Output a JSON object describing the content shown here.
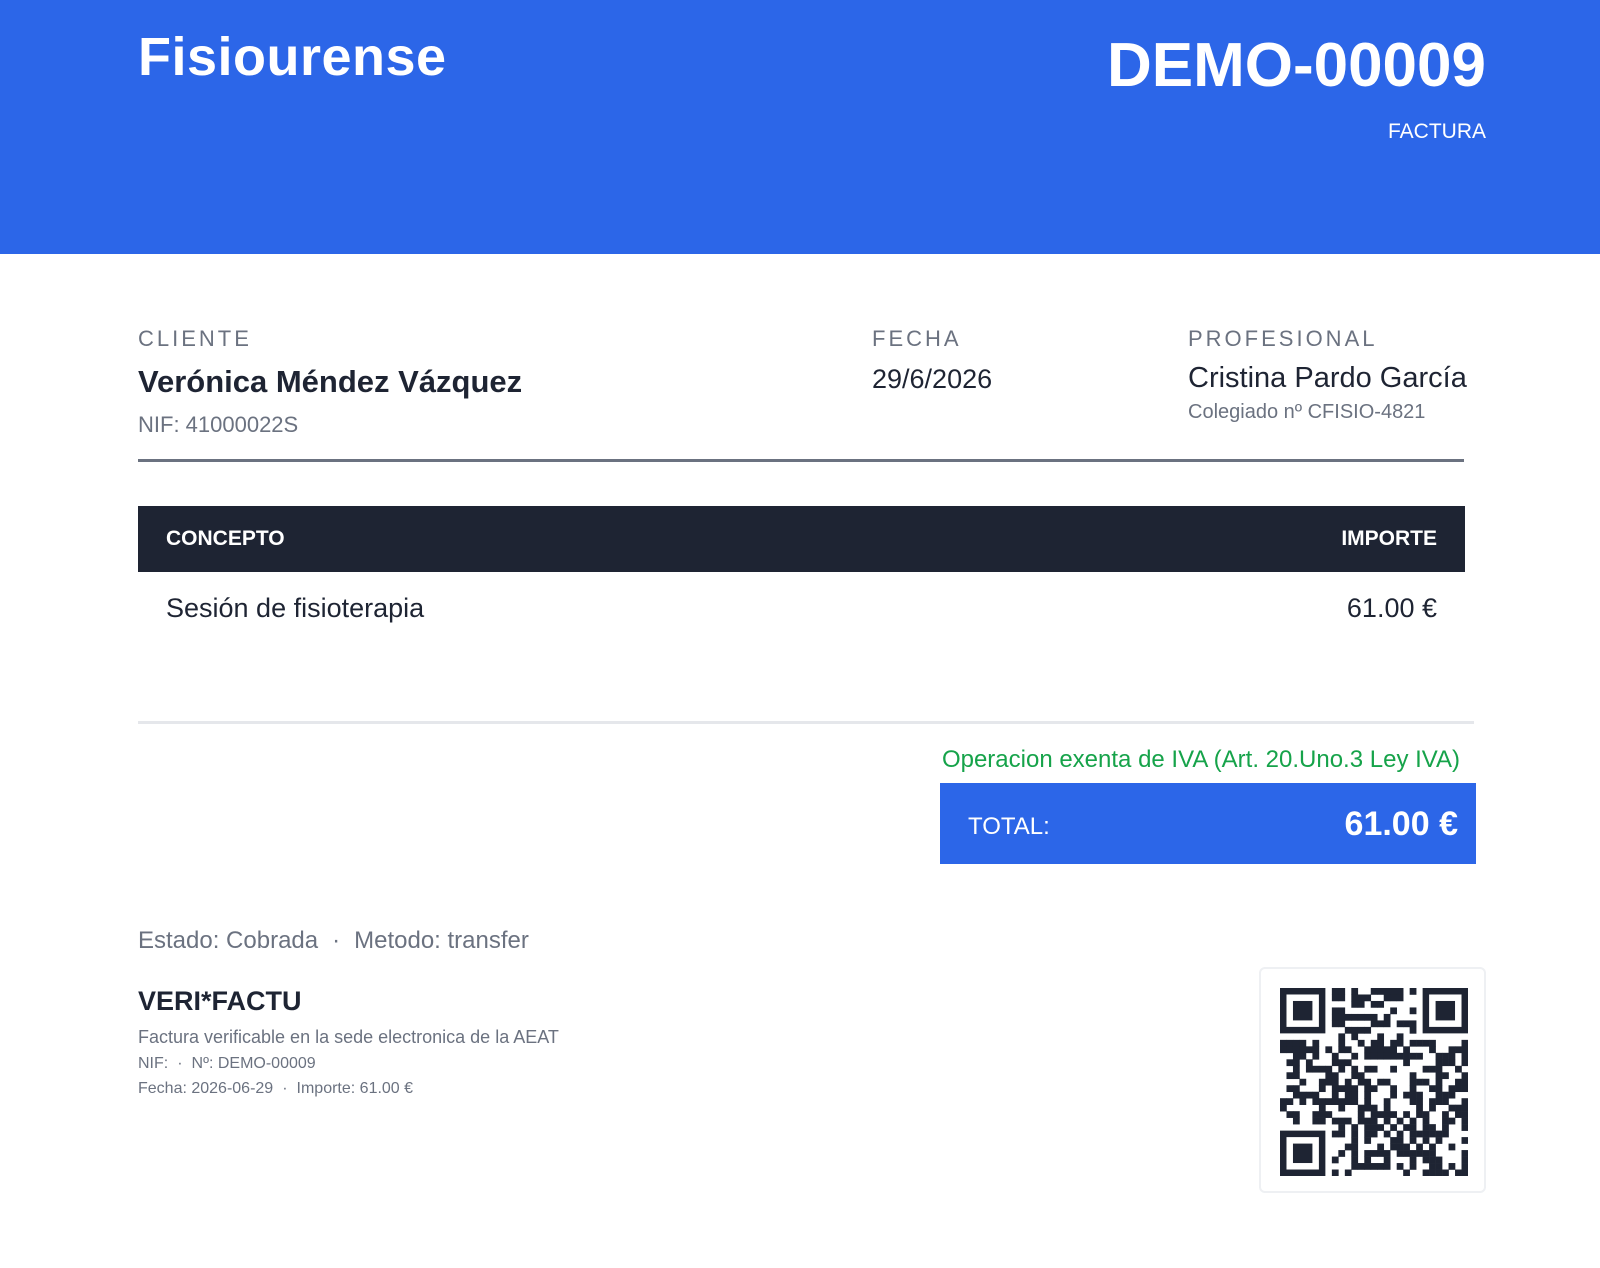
{
  "header": {
    "brand": "Fisiourense",
    "invoice_number": "DEMO-00009",
    "invoice_type": "FACTURA"
  },
  "cliente": {
    "label": "CLIENTE",
    "name": "Verónica Méndez Vázquez",
    "nif": "NIF: 41000022S"
  },
  "fecha": {
    "label": "FECHA",
    "value": "29/6/2026"
  },
  "profesional": {
    "label": "PROFESIONAL",
    "name": "Cristina Pardo García",
    "colegiado": "Colegiado nº CFISIO-4821"
  },
  "table": {
    "headers": {
      "concepto": "CONCEPTO",
      "importe": "IMPORTE"
    },
    "rows": [
      {
        "concepto": "Sesión de fisioterapia",
        "importe": "61.00 €"
      }
    ]
  },
  "summary": {
    "iva_note": "Operacion exenta de IVA (Art. 20.Uno.3 Ley IVA)",
    "total_label": "TOTAL:",
    "total_value": "61.00 €"
  },
  "payment": {
    "estado": "Estado: Cobrada",
    "separator": "·",
    "metodo": "Metodo: transfer"
  },
  "verifactu": {
    "title": "VERI*FACTU",
    "description": "Factura verificable en la sede electronica de la AEAT",
    "nif": "NIF:",
    "numero": "Nº: DEMO-00009",
    "fecha": "Fecha: 2026-06-29",
    "importe": "Importe: 61.00 €",
    "separator": "·"
  },
  "colors": {
    "brand_blue": "#2c66e8",
    "dark_navy": "#1e2433",
    "muted_gray": "#6b7280",
    "exempt_green": "#16a34a"
  },
  "icons": {
    "qr": "qr-code-icon"
  }
}
